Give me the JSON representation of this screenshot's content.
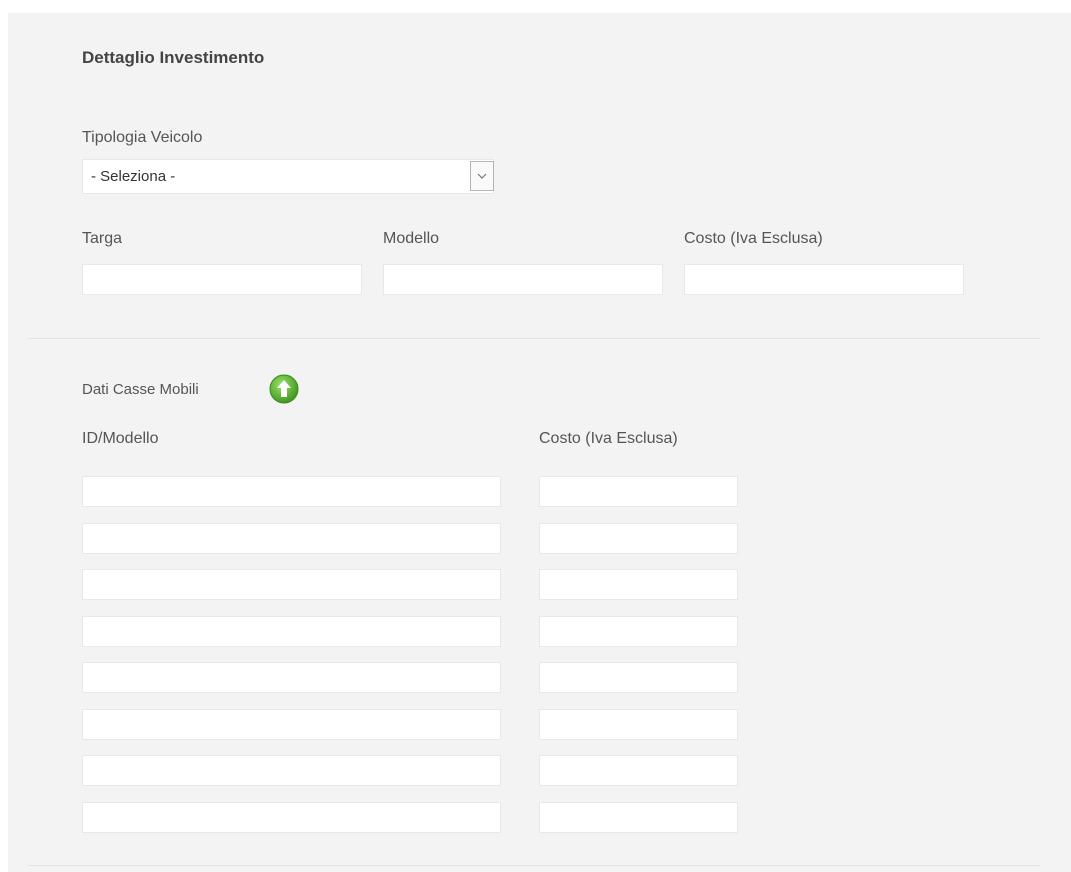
{
  "section_title": "Dettaglio Investimento",
  "vehicle_type": {
    "label": "Tipologia Veicolo",
    "selected": "- Seleziona -"
  },
  "fields": {
    "targa": {
      "label": "Targa",
      "value": ""
    },
    "modello": {
      "label": "Modello",
      "value": ""
    },
    "costo": {
      "label": "Costo (Iva Esclusa)",
      "value": ""
    }
  },
  "casse_mobili": {
    "title": "Dati Casse Mobili",
    "add_icon": "green-up-arrow-icon",
    "col_id": "ID/Modello",
    "col_costo": "Costo (Iva Esclusa)",
    "rows": [
      {
        "id": "",
        "costo": ""
      },
      {
        "id": "",
        "costo": ""
      },
      {
        "id": "",
        "costo": ""
      },
      {
        "id": "",
        "costo": ""
      },
      {
        "id": "",
        "costo": ""
      },
      {
        "id": "",
        "costo": ""
      },
      {
        "id": "",
        "costo": ""
      },
      {
        "id": "",
        "costo": ""
      }
    ]
  },
  "colors": {
    "panel": "#f3f3f3",
    "icon_green": "#5cb82e"
  }
}
